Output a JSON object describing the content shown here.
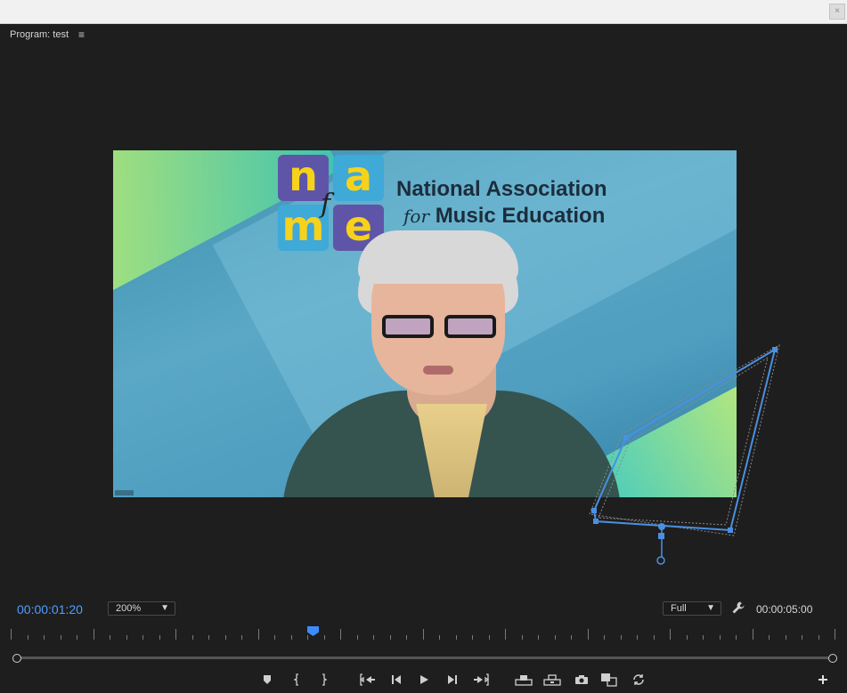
{
  "panel": {
    "title": "Program: test",
    "menu_icon": "hamburger-menu-icon",
    "menu_glyph": "≡"
  },
  "video": {
    "logo_letters": [
      "n",
      "a",
      "m",
      "e"
    ],
    "logo_center": "f",
    "org_line1": "National Association",
    "org_line2_prefix": "for",
    "org_line2": "Music Education"
  },
  "timecode": {
    "current": "00:00:01:20",
    "duration": "00:00:05:00"
  },
  "zoom": {
    "selected": "200%"
  },
  "resolution": {
    "selected": "Full"
  },
  "playback": {
    "position_fraction": 0.367
  },
  "controls": [
    {
      "name": "add-marker-button",
      "icon": "marker-icon"
    },
    {
      "name": "mark-in-button",
      "icon": "mark-in-icon"
    },
    {
      "name": "mark-out-button",
      "icon": "mark-out-icon"
    },
    {
      "name": "go-to-in-button",
      "icon": "go-to-in-icon"
    },
    {
      "name": "step-back-button",
      "icon": "step-back-icon"
    },
    {
      "name": "play-button",
      "icon": "play-icon"
    },
    {
      "name": "step-forward-button",
      "icon": "step-forward-icon"
    },
    {
      "name": "go-to-out-button",
      "icon": "go-to-out-icon"
    },
    {
      "name": "lift-button",
      "icon": "lift-icon"
    },
    {
      "name": "extract-button",
      "icon": "extract-icon"
    },
    {
      "name": "export-frame-button",
      "icon": "camera-icon"
    },
    {
      "name": "comparison-view-button",
      "icon": "comparison-view-icon"
    },
    {
      "name": "proxy-toggle-button",
      "icon": "proxy-toggle-icon"
    },
    {
      "name": "button-editor-button",
      "icon": "plus-icon"
    }
  ],
  "colors": {
    "accent": "#4d9fff",
    "panel_bg": "#1e1e1e",
    "mask_stroke": "#4a90e2"
  }
}
